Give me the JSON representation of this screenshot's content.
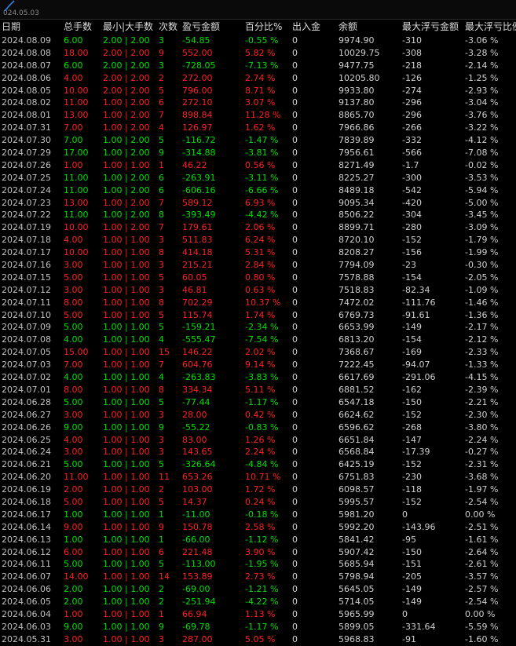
{
  "topbar": {
    "date_label": "024.05.03"
  },
  "headers": [
    "日期",
    "总手数",
    "最小|大手数",
    "次数",
    "盈亏金额",
    "百分比%",
    "出入金",
    "余额",
    "最大浮亏金额",
    "最大浮亏比例"
  ],
  "rows": [
    {
      "type": "win",
      "date": "2024.08.09",
      "lots": "6.00",
      "minmax": "2.00 | 2.00",
      "count": "3",
      "pnl": "-54.85",
      "pct": "-0.55 %",
      "flow": "0",
      "balance": "9974.90",
      "maxloss": "-310",
      "maxpct": "-3.06 %"
    },
    {
      "type": "loss",
      "date": "2024.08.08",
      "lots": "18.00",
      "minmax": "2.00 | 2.00",
      "count": "9",
      "pnl": "552.00",
      "pct": "5.82 %",
      "flow": "0",
      "balance": "10029.75",
      "maxloss": "-308",
      "maxpct": "-3.28 %"
    },
    {
      "type": "win",
      "date": "2024.08.07",
      "lots": "6.00",
      "minmax": "2.00 | 2.00",
      "count": "3",
      "pnl": "-728.05",
      "pct": "-7.13 %",
      "flow": "0",
      "balance": "9477.75",
      "maxloss": "-218",
      "maxpct": "-2.14 %"
    },
    {
      "type": "loss",
      "date": "2024.08.06",
      "lots": "4.00",
      "minmax": "2.00 | 2.00",
      "count": "2",
      "pnl": "272.00",
      "pct": "2.74 %",
      "flow": "0",
      "balance": "10205.80",
      "maxloss": "-126",
      "maxpct": "-1.25 %"
    },
    {
      "type": "loss",
      "date": "2024.08.05",
      "lots": "10.00",
      "minmax": "2.00 | 2.00",
      "count": "5",
      "pnl": "796.00",
      "pct": "8.71 %",
      "flow": "0",
      "balance": "9933.80",
      "maxloss": "-274",
      "maxpct": "-2.93 %"
    },
    {
      "type": "loss",
      "date": "2024.08.02",
      "lots": "11.00",
      "minmax": "1.00 | 2.00",
      "count": "6",
      "pnl": "272.10",
      "pct": "3.07 %",
      "flow": "0",
      "balance": "9137.80",
      "maxloss": "-296",
      "maxpct": "-3.04 %"
    },
    {
      "type": "loss",
      "date": "2024.08.01",
      "lots": "13.00",
      "minmax": "1.00 | 2.00",
      "count": "7",
      "pnl": "898.84",
      "pct": "11.28 %",
      "flow": "0",
      "balance": "8865.70",
      "maxloss": "-296",
      "maxpct": "-3.76 %"
    },
    {
      "type": "loss",
      "date": "2024.07.31",
      "lots": "7.00",
      "minmax": "1.00 | 2.00",
      "count": "4",
      "pnl": "126.97",
      "pct": "1.62 %",
      "flow": "0",
      "balance": "7966.86",
      "maxloss": "-266",
      "maxpct": "-3.22 %"
    },
    {
      "type": "win",
      "date": "2024.07.30",
      "lots": "7.00",
      "minmax": "1.00 | 2.00",
      "count": "5",
      "pnl": "-116.72",
      "pct": "-1.47 %",
      "flow": "0",
      "balance": "7839.89",
      "maxloss": "-332",
      "maxpct": "-4.12 %"
    },
    {
      "type": "win",
      "date": "2024.07.29",
      "lots": "17.00",
      "minmax": "1.00 | 2.00",
      "count": "9",
      "pnl": "-314.88",
      "pct": "-3.81 %",
      "flow": "0",
      "balance": "7956.61",
      "maxloss": "-566",
      "maxpct": "-7.08 %"
    },
    {
      "type": "loss",
      "date": "2024.07.26",
      "lots": "1.00",
      "minmax": "1.00 | 1.00",
      "count": "1",
      "pnl": "46.22",
      "pct": "0.56 %",
      "flow": "0",
      "balance": "8271.49",
      "maxloss": "-1.7",
      "maxpct": "-0.02 %"
    },
    {
      "type": "win",
      "date": "2024.07.25",
      "lots": "11.00",
      "minmax": "1.00 | 2.00",
      "count": "6",
      "pnl": "-263.91",
      "pct": "-3.11 %",
      "flow": "0",
      "balance": "8225.27",
      "maxloss": "-300",
      "maxpct": "-3.53 %"
    },
    {
      "type": "win",
      "date": "2024.07.24",
      "lots": "11.00",
      "minmax": "1.00 | 2.00",
      "count": "6",
      "pnl": "-606.16",
      "pct": "-6.66 %",
      "flow": "0",
      "balance": "8489.18",
      "maxloss": "-542",
      "maxpct": "-5.94 %"
    },
    {
      "type": "loss",
      "date": "2024.07.23",
      "lots": "13.00",
      "minmax": "1.00 | 2.00",
      "count": "7",
      "pnl": "589.12",
      "pct": "6.93 %",
      "flow": "0",
      "balance": "9095.34",
      "maxloss": "-420",
      "maxpct": "-5.00 %"
    },
    {
      "type": "win",
      "date": "2024.07.22",
      "lots": "11.00",
      "minmax": "1.00 | 2.00",
      "count": "8",
      "pnl": "-393.49",
      "pct": "-4.42 %",
      "flow": "0",
      "balance": "8506.22",
      "maxloss": "-304",
      "maxpct": "-3.45 %"
    },
    {
      "type": "loss",
      "date": "2024.07.19",
      "lots": "10.00",
      "minmax": "1.00 | 2.00",
      "count": "7",
      "pnl": "179.61",
      "pct": "2.06 %",
      "flow": "0",
      "balance": "8899.71",
      "maxloss": "-280",
      "maxpct": "-3.09 %"
    },
    {
      "type": "loss",
      "date": "2024.07.18",
      "lots": "4.00",
      "minmax": "1.00 | 1.00",
      "count": "3",
      "pnl": "511.83",
      "pct": "6.24 %",
      "flow": "0",
      "balance": "8720.10",
      "maxloss": "-152",
      "maxpct": "-1.79 %"
    },
    {
      "type": "loss",
      "date": "2024.07.17",
      "lots": "10.00",
      "minmax": "1.00 | 1.00",
      "count": "8",
      "pnl": "414.18",
      "pct": "5.31 %",
      "flow": "0",
      "balance": "8208.27",
      "maxloss": "-156",
      "maxpct": "-1.99 %"
    },
    {
      "type": "loss",
      "date": "2024.07.16",
      "lots": "3.00",
      "minmax": "1.00 | 1.00",
      "count": "3",
      "pnl": "215.21",
      "pct": "2.84 %",
      "flow": "0",
      "balance": "7794.09",
      "maxloss": "-23",
      "maxpct": "-0.30 %"
    },
    {
      "type": "loss",
      "date": "2024.07.15",
      "lots": "5.00",
      "minmax": "1.00 | 1.00",
      "count": "5",
      "pnl": "60.05",
      "pct": "0.80 %",
      "flow": "0",
      "balance": "7578.88",
      "maxloss": "-154",
      "maxpct": "-2.05 %"
    },
    {
      "type": "loss",
      "date": "2024.07.12",
      "lots": "3.00",
      "minmax": "1.00 | 1.00",
      "count": "3",
      "pnl": "46.81",
      "pct": "0.63 %",
      "flow": "0",
      "balance": "7518.83",
      "maxloss": "-82.34",
      "maxpct": "-1.09 %"
    },
    {
      "type": "loss",
      "date": "2024.07.11",
      "lots": "8.00",
      "minmax": "1.00 | 1.00",
      "count": "8",
      "pnl": "702.29",
      "pct": "10.37 %",
      "flow": "0",
      "balance": "7472.02",
      "maxloss": "-111.76",
      "maxpct": "-1.46 %"
    },
    {
      "type": "loss",
      "date": "2024.07.10",
      "lots": "5.00",
      "minmax": "1.00 | 1.00",
      "count": "5",
      "pnl": "115.74",
      "pct": "1.74 %",
      "flow": "0",
      "balance": "6769.73",
      "maxloss": "-91.61",
      "maxpct": "-1.36 %"
    },
    {
      "type": "win",
      "date": "2024.07.09",
      "lots": "5.00",
      "minmax": "1.00 | 1.00",
      "count": "5",
      "pnl": "-159.21",
      "pct": "-2.34 %",
      "flow": "0",
      "balance": "6653.99",
      "maxloss": "-149",
      "maxpct": "-2.17 %"
    },
    {
      "type": "win",
      "date": "2024.07.08",
      "lots": "4.00",
      "minmax": "1.00 | 1.00",
      "count": "4",
      "pnl": "-555.47",
      "pct": "-7.54 %",
      "flow": "0",
      "balance": "6813.20",
      "maxloss": "-154",
      "maxpct": "-2.12 %"
    },
    {
      "type": "loss",
      "date": "2024.07.05",
      "lots": "15.00",
      "minmax": "1.00 | 1.00",
      "count": "15",
      "pnl": "146.22",
      "pct": "2.02 %",
      "flow": "0",
      "balance": "7368.67",
      "maxloss": "-169",
      "maxpct": "-2.33 %"
    },
    {
      "type": "loss",
      "date": "2024.07.03",
      "lots": "7.00",
      "minmax": "1.00 | 1.00",
      "count": "7",
      "pnl": "604.76",
      "pct": "9.14 %",
      "flow": "0",
      "balance": "7222.45",
      "maxloss": "-94.07",
      "maxpct": "-1.33 %"
    },
    {
      "type": "win",
      "date": "2024.07.02",
      "lots": "4.00",
      "minmax": "1.00 | 1.00",
      "count": "4",
      "pnl": "-263.83",
      "pct": "-3.83 %",
      "flow": "0",
      "balance": "6617.69",
      "maxloss": "-291.06",
      "maxpct": "-4.15 %"
    },
    {
      "type": "loss",
      "date": "2024.07.01",
      "lots": "8.00",
      "minmax": "1.00 | 1.00",
      "count": "8",
      "pnl": "334.34",
      "pct": "5.11 %",
      "flow": "0",
      "balance": "6881.52",
      "maxloss": "-162",
      "maxpct": "-2.39 %"
    },
    {
      "type": "win",
      "date": "2024.06.28",
      "lots": "5.00",
      "minmax": "1.00 | 1.00",
      "count": "5",
      "pnl": "-77.44",
      "pct": "-1.17 %",
      "flow": "0",
      "balance": "6547.18",
      "maxloss": "-150",
      "maxpct": "-2.21 %"
    },
    {
      "type": "loss",
      "date": "2024.06.27",
      "lots": "3.00",
      "minmax": "1.00 | 1.00",
      "count": "3",
      "pnl": "28.00",
      "pct": "0.42 %",
      "flow": "0",
      "balance": "6624.62",
      "maxloss": "-152",
      "maxpct": "-2.30 %"
    },
    {
      "type": "win",
      "date": "2024.06.26",
      "lots": "9.00",
      "minmax": "1.00 | 1.00",
      "count": "9",
      "pnl": "-55.22",
      "pct": "-0.83 %",
      "flow": "0",
      "balance": "6596.62",
      "maxloss": "-268",
      "maxpct": "-3.80 %"
    },
    {
      "type": "loss",
      "date": "2024.06.25",
      "lots": "4.00",
      "minmax": "1.00 | 1.00",
      "count": "3",
      "pnl": "83.00",
      "pct": "1.26 %",
      "flow": "0",
      "balance": "6651.84",
      "maxloss": "-147",
      "maxpct": "-2.24 %"
    },
    {
      "type": "loss",
      "date": "2024.06.24",
      "lots": "3.00",
      "minmax": "1.00 | 1.00",
      "count": "3",
      "pnl": "143.65",
      "pct": "2.24 %",
      "flow": "0",
      "balance": "6568.84",
      "maxloss": "-17.39",
      "maxpct": "-0.27 %"
    },
    {
      "type": "win",
      "date": "2024.06.21",
      "lots": "5.00",
      "minmax": "1.00 | 1.00",
      "count": "5",
      "pnl": "-326.64",
      "pct": "-4.84 %",
      "flow": "0",
      "balance": "6425.19",
      "maxloss": "-152",
      "maxpct": "-2.31 %"
    },
    {
      "type": "loss",
      "date": "2024.06.20",
      "lots": "11.00",
      "minmax": "1.00 | 1.00",
      "count": "11",
      "pnl": "653.26",
      "pct": "10.71 %",
      "flow": "0",
      "balance": "6751.83",
      "maxloss": "-230",
      "maxpct": "-3.68 %"
    },
    {
      "type": "loss",
      "date": "2024.06.19",
      "lots": "2.00",
      "minmax": "1.00 | 1.00",
      "count": "2",
      "pnl": "103.00",
      "pct": "1.72 %",
      "flow": "0",
      "balance": "6098.57",
      "maxloss": "-118",
      "maxpct": "-1.97 %"
    },
    {
      "type": "loss",
      "date": "2024.06.18",
      "lots": "5.00",
      "minmax": "1.00 | 1.00",
      "count": "5",
      "pnl": "14.37",
      "pct": "0.24 %",
      "flow": "0",
      "balance": "5995.57",
      "maxloss": "-152",
      "maxpct": "-2.54 %"
    },
    {
      "type": "win",
      "date": "2024.06.17",
      "lots": "1.00",
      "minmax": "1.00 | 1.00",
      "count": "1",
      "pnl": "-11.00",
      "pct": "-0.18 %",
      "flow": "0",
      "balance": "5981.20",
      "maxloss": "0",
      "maxpct": "0.00 %"
    },
    {
      "type": "loss",
      "date": "2024.06.14",
      "lots": "9.00",
      "minmax": "1.00 | 1.00",
      "count": "9",
      "pnl": "150.78",
      "pct": "2.58 %",
      "flow": "0",
      "balance": "5992.20",
      "maxloss": "-143.96",
      "maxpct": "-2.51 %"
    },
    {
      "type": "win",
      "date": "2024.06.13",
      "lots": "1.00",
      "minmax": "1.00 | 1.00",
      "count": "1",
      "pnl": "-66.00",
      "pct": "-1.12 %",
      "flow": "0",
      "balance": "5841.42",
      "maxloss": "-95",
      "maxpct": "-1.61 %"
    },
    {
      "type": "loss",
      "date": "2024.06.12",
      "lots": "6.00",
      "minmax": "1.00 | 1.00",
      "count": "6",
      "pnl": "221.48",
      "pct": "3.90 %",
      "flow": "0",
      "balance": "5907.42",
      "maxloss": "-150",
      "maxpct": "-2.64 %"
    },
    {
      "type": "win",
      "date": "2024.06.11",
      "lots": "5.00",
      "minmax": "1.00 | 1.00",
      "count": "5",
      "pnl": "-113.00",
      "pct": "-1.95 %",
      "flow": "0",
      "balance": "5685.94",
      "maxloss": "-151",
      "maxpct": "-2.61 %"
    },
    {
      "type": "loss",
      "date": "2024.06.07",
      "lots": "14.00",
      "minmax": "1.00 | 1.00",
      "count": "14",
      "pnl": "153.89",
      "pct": "2.73 %",
      "flow": "0",
      "balance": "5798.94",
      "maxloss": "-205",
      "maxpct": "-3.57 %"
    },
    {
      "type": "win",
      "date": "2024.06.06",
      "lots": "2.00",
      "minmax": "1.00 | 1.00",
      "count": "2",
      "pnl": "-69.00",
      "pct": "-1.21 %",
      "flow": "0",
      "balance": "5645.05",
      "maxloss": "-149",
      "maxpct": "-2.57 %"
    },
    {
      "type": "win",
      "date": "2024.06.05",
      "lots": "2.00",
      "minmax": "1.00 | 1.00",
      "count": "2",
      "pnl": "-251.94",
      "pct": "-4.22 %",
      "flow": "0",
      "balance": "5714.05",
      "maxloss": "-149",
      "maxpct": "-2.54 %"
    },
    {
      "type": "loss",
      "date": "2024.06.04",
      "lots": "1.00",
      "minmax": "1.00 | 1.00",
      "count": "1",
      "pnl": "66.94",
      "pct": "1.13 %",
      "flow": "0",
      "balance": "5965.99",
      "maxloss": "0",
      "maxpct": "0.00 %"
    },
    {
      "type": "win",
      "date": "2024.06.03",
      "lots": "9.00",
      "minmax": "1.00 | 1.00",
      "count": "9",
      "pnl": "-69.78",
      "pct": "-1.17 %",
      "flow": "0",
      "balance": "5899.05",
      "maxloss": "-331.64",
      "maxpct": "-5.59 %"
    },
    {
      "type": "loss",
      "date": "2024.05.31",
      "lots": "3.00",
      "minmax": "1.00 | 1.00",
      "count": "3",
      "pnl": "287.00",
      "pct": "5.05 %",
      "flow": "0",
      "balance": "5968.83",
      "maxloss": "-91",
      "maxpct": "-1.60 %"
    }
  ]
}
